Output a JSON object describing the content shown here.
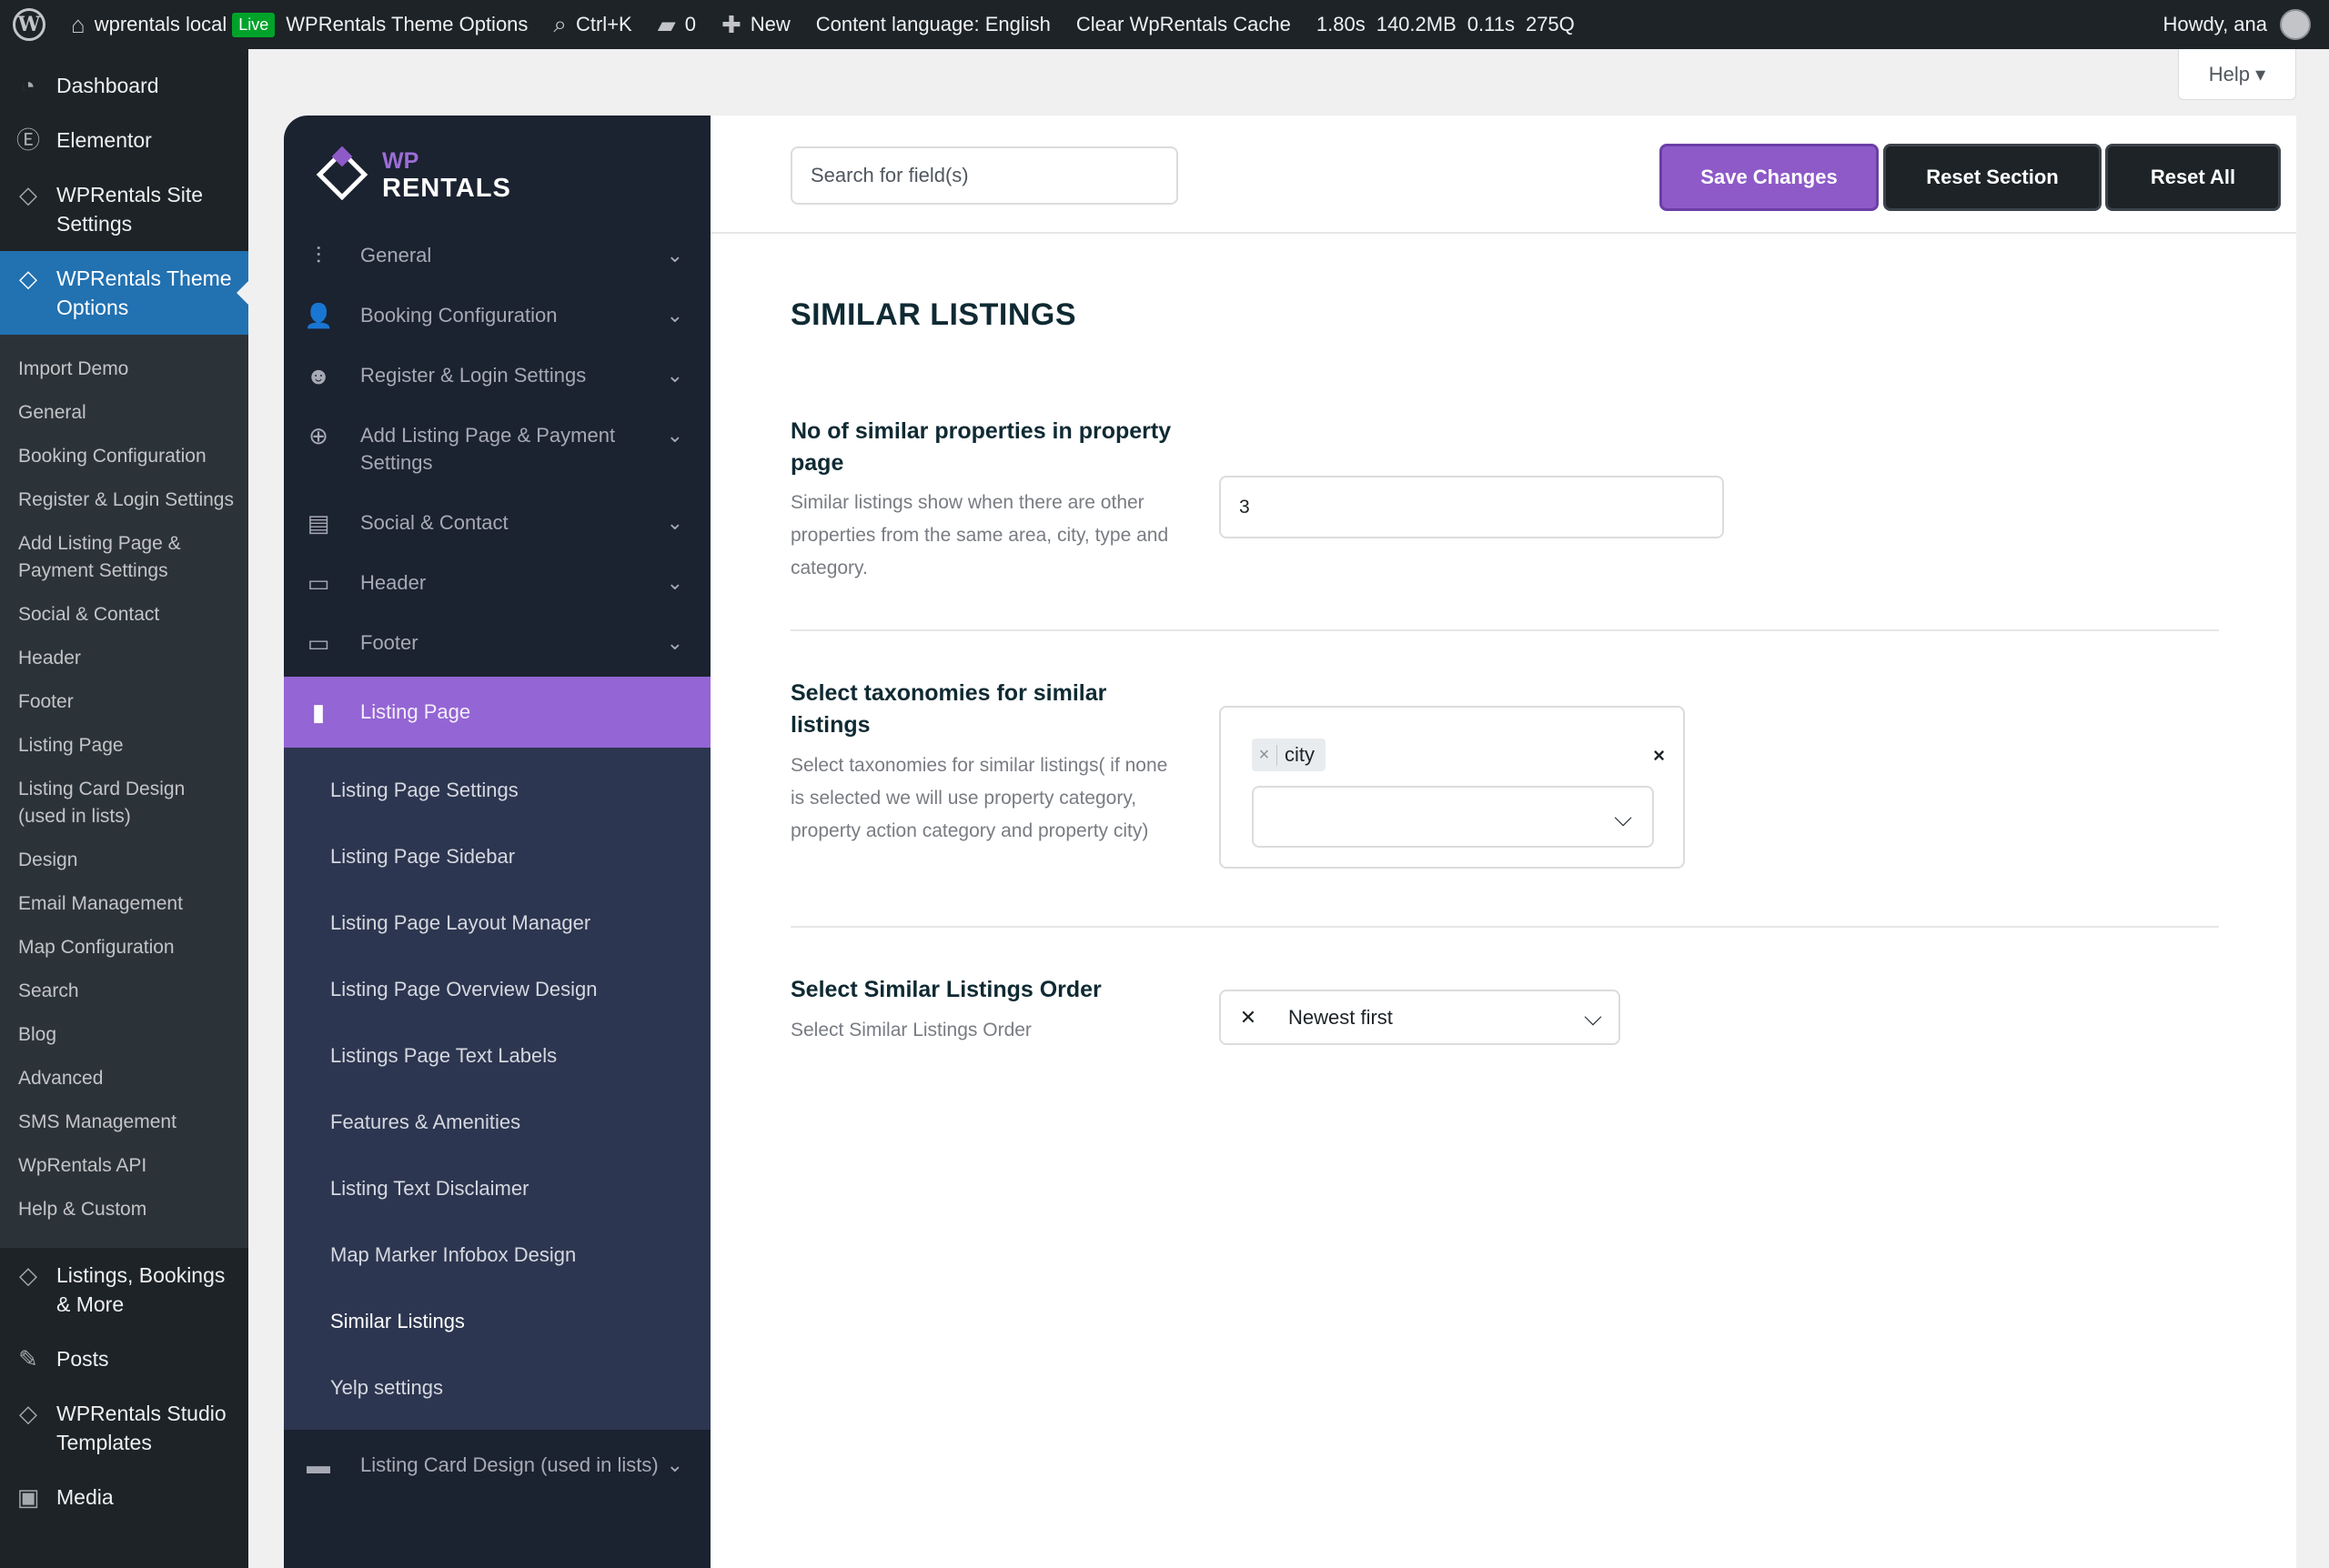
{
  "admin_bar": {
    "site_name": "wprentals local",
    "live_badge": "Live",
    "theme_options": "WPRentals Theme Options",
    "search_shortcut": "Ctrl+K",
    "comments_count": "0",
    "new_label": "New",
    "content_language": "Content language: English",
    "clear_cache": "Clear WpRentals Cache",
    "stats": [
      "1.80s",
      "140.2MB",
      "0.11s",
      "275Q"
    ],
    "greeting": "Howdy, ana"
  },
  "help_tab": "Help ▾",
  "wp_menu": {
    "top_items": [
      {
        "label": "Dashboard",
        "icon": "dashboard-icon"
      },
      {
        "label": "Elementor",
        "icon": "elementor-icon"
      },
      {
        "label": "WPRentals Site Settings",
        "icon": "diamond-icon"
      }
    ],
    "active_item": {
      "label": "WPRentals Theme Options",
      "icon": "diamond-icon"
    },
    "sub_items": [
      "Import Demo",
      "General",
      "Booking Configuration",
      "Register & Login Settings",
      "Add Listing Page & Payment Settings",
      "Social & Contact",
      "Header",
      "Footer",
      "Listing Page",
      "Listing Card Design (used in lists)",
      "Design",
      "Email Management",
      "Map Configuration",
      "Search",
      "Blog",
      "Advanced",
      "SMS Management",
      "WpRentals API",
      "Help & Custom"
    ],
    "bottom_items": [
      {
        "label": "Listings, Bookings & More",
        "icon": "diamond-icon"
      },
      {
        "label": "Posts",
        "icon": "pin-icon"
      },
      {
        "label": "WPRentals Studio Templates",
        "icon": "diamond-icon"
      },
      {
        "label": "Media",
        "icon": "media-icon"
      }
    ]
  },
  "brand": {
    "line1": "WP",
    "line2": "RENTALS"
  },
  "options_nav": {
    "items": [
      {
        "label": "General",
        "icon": "sliders-icon"
      },
      {
        "label": "Booking Configuration",
        "icon": "user-icon"
      },
      {
        "label": "Register & Login Settings",
        "icon": "smile-icon"
      },
      {
        "label": "Add Listing Page & Payment Settings",
        "icon": "plus-circle-icon"
      },
      {
        "label": "Social & Contact",
        "icon": "contact-card-icon"
      },
      {
        "label": "Header",
        "icon": "monitor-icon"
      },
      {
        "label": "Footer",
        "icon": "desktop-icon"
      }
    ],
    "active": {
      "label": "Listing Page",
      "icon": "document-icon"
    },
    "sub_items": [
      "Listing Page Settings",
      "Listing Page Sidebar",
      "Listing Page Layout Manager",
      "Listing Page Overview Design",
      "Listings Page Text Labels",
      "Features & Amenities",
      "Listing Text Disclaimer",
      "Map Marker Infobox Design",
      "Similar Listings",
      "Yelp settings"
    ],
    "current_sub": "Similar Listings",
    "next_item": {
      "label": "Listing Card Design (used in lists)",
      "icon": "card-icon"
    }
  },
  "toolbar": {
    "search_placeholder": "Search for field(s)",
    "save_label": "Save Changes",
    "reset_section_label": "Reset Section",
    "reset_all_label": "Reset All"
  },
  "section": {
    "title": "SIMILAR LISTINGS",
    "fields": [
      {
        "label": "No of similar properties in property page",
        "description": "Similar listings show when there are other properties from the same area, city, type and category.",
        "value": "3"
      },
      {
        "label": "Select taxonomies for similar listings",
        "description": "Select taxonomies for similar listings( if none is selected we will use property category, property action category and property city)",
        "chips": [
          "city"
        ],
        "clear_symbol": "×"
      },
      {
        "label": "Select Similar Listings Order",
        "description": "Select Similar Listings Order",
        "value": "Newest first"
      }
    ]
  },
  "colors": {
    "accent": "#8e5ac8",
    "wp_blue": "#2271b1",
    "nav_bg": "#1b2230",
    "subnav_bg": "#2d3650"
  }
}
